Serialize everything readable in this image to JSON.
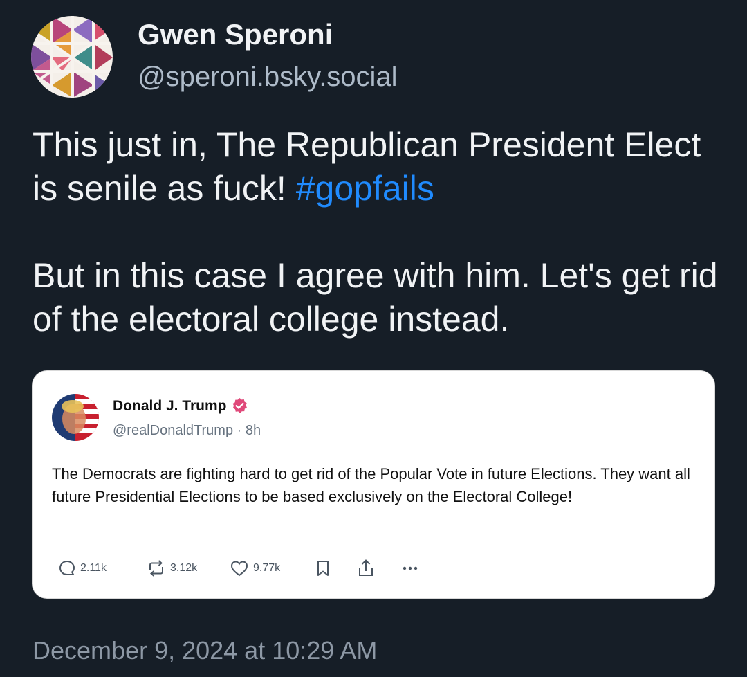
{
  "author": {
    "name": "Gwen Speroni",
    "handle": "@speroni.bsky.social",
    "avatar_icon": "geometric-pattern-avatar"
  },
  "post": {
    "line1": "This just in, The Republican President Elect is senile as fuck! ",
    "hashtag": "#gopfails",
    "line2": "But in this case I agree with him. Let's get rid of the electoral college instead."
  },
  "quote": {
    "name": "Donald J. Trump",
    "handle": "@realDonaldTrump",
    "age": "· 8h",
    "text": "The Democrats are fighting hard to get rid of the Popular Vote in future Elections. They want all future Presidential Elections to be based exclusively on the Electoral College!",
    "replies": "2.11k",
    "reposts": "3.12k",
    "likes": "9.77k",
    "verified_icon": "verified-badge-icon",
    "verified_color": "#e0497a"
  },
  "timestamp": "December 9, 2024 at 10:29 AM",
  "colors": {
    "background": "#161e27",
    "hashtag": "#208bfe",
    "secondary_text": "#aebbc9"
  }
}
